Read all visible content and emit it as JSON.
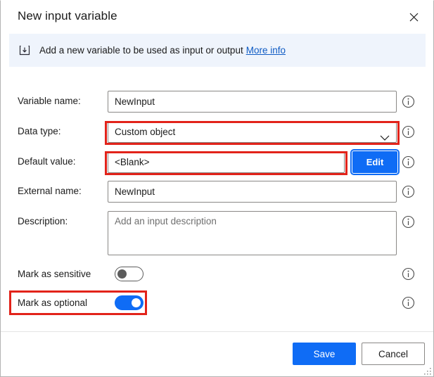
{
  "window": {
    "title": "New input variable",
    "close_icon": "close-icon"
  },
  "banner": {
    "icon": "input-variable-icon",
    "text": "Add a new variable to be used as input or output",
    "link_label": "More info",
    "link_color": "#0f5bc4",
    "background": "#eff4fc"
  },
  "form": {
    "fields": [
      {
        "label": "Variable name:",
        "type": "text",
        "value": "NewInput",
        "info_icon": "info-icon",
        "highlighted": false
      },
      {
        "label": "Data type:",
        "type": "dropdown",
        "value": "Custom object",
        "chevron_icon": "chevron-down-icon",
        "info_icon": "info-icon",
        "highlighted": true
      },
      {
        "label": "Default value:",
        "type": "text-with-button",
        "value": "<Blank>",
        "button_label": "Edit",
        "info_icon": "info-icon",
        "highlighted": true
      },
      {
        "label": "External name:",
        "type": "text",
        "value": "NewInput",
        "info_icon": "info-icon",
        "highlighted": false
      },
      {
        "label": "Description:",
        "type": "textarea",
        "value": "",
        "placeholder": "Add an input description",
        "info_icon": "info-icon",
        "highlighted": false
      }
    ],
    "toggles": [
      {
        "label": "Mark as sensitive",
        "state": "off",
        "info_icon": "info-icon",
        "highlighted": false
      },
      {
        "label": "Mark as optional",
        "state": "on",
        "info_icon": "info-icon",
        "highlighted": true
      }
    ]
  },
  "footer": {
    "save_label": "Save",
    "cancel_label": "Cancel"
  },
  "colors": {
    "accent": "#0f6cf5",
    "annotation": "#e2231a",
    "border": "#8a8886"
  }
}
